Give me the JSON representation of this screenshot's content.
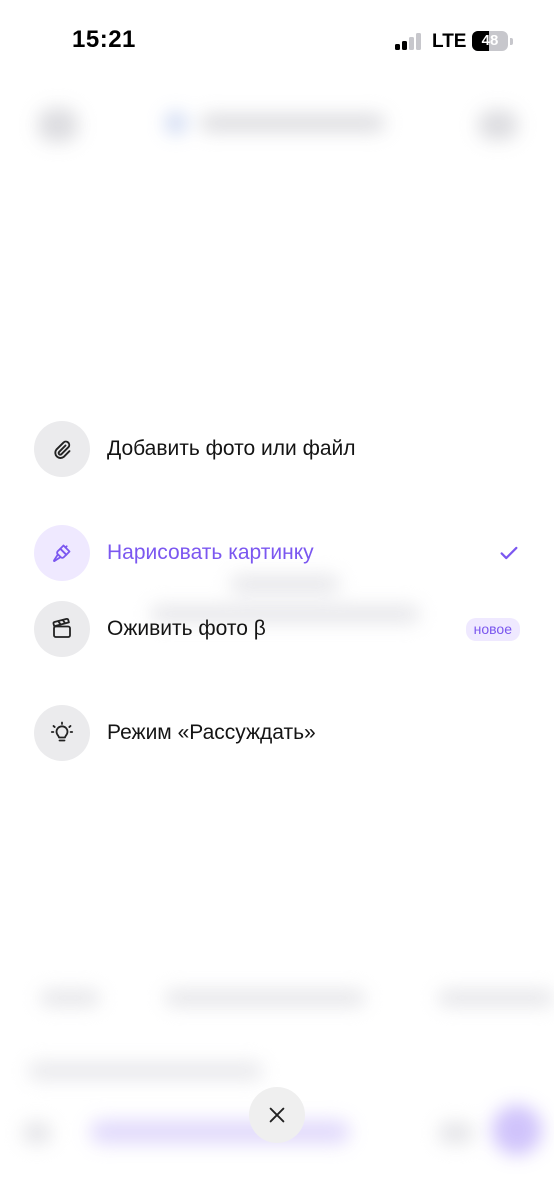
{
  "status_bar": {
    "time": "15:21",
    "network": "LTE",
    "battery_level": "48",
    "battery_fraction": 0.48
  },
  "menu": {
    "items": [
      {
        "label": "Добавить фото или файл",
        "icon": "paperclip-icon",
        "selected": false
      },
      {
        "label": "Нарисовать картинку",
        "icon": "paintbrush-icon",
        "selected": true
      },
      {
        "label": "Оживить фото β",
        "icon": "clapperboard-icon",
        "selected": false,
        "badge": "новое"
      },
      {
        "label": "Режим «Рассуждать»",
        "icon": "lightbulb-icon",
        "selected": false
      }
    ]
  },
  "colors": {
    "accent": "#7b57f0",
    "icon_bg": "#ebebed",
    "badge_bg": "#efe9ff"
  },
  "close_button": {
    "icon": "close-icon"
  }
}
